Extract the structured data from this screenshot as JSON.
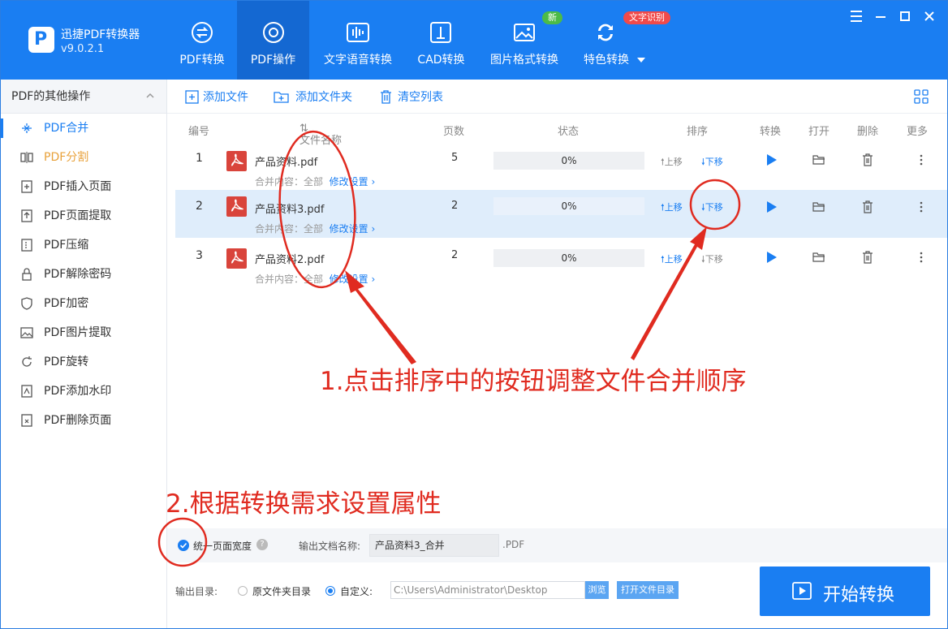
{
  "app": {
    "name": "迅捷PDF转换器",
    "version": "v9.0.2.1"
  },
  "nav_tabs": [
    {
      "label": "PDF转换",
      "icon": "pdf-convert-icon"
    },
    {
      "label": "PDF操作",
      "icon": "pdf-operate-icon",
      "active": true
    },
    {
      "label": "文字语音转换",
      "icon": "voice-wave-icon"
    },
    {
      "label": "CAD转换",
      "icon": "cad-icon"
    },
    {
      "label": "图片格式转换",
      "icon": "image-icon"
    },
    {
      "label": "特色转换",
      "icon": "special-convert-icon"
    }
  ],
  "badges": {
    "new": "新",
    "ocr": "文字识别"
  },
  "sidebar": {
    "title": "PDF的其他操作",
    "items": [
      {
        "label": "PDF合并",
        "icon": "merge-icon",
        "active": true
      },
      {
        "label": "PDF分割",
        "icon": "split-icon"
      },
      {
        "label": "PDF插入页面",
        "icon": "insert-page-icon"
      },
      {
        "label": "PDF页面提取",
        "icon": "extract-page-icon"
      },
      {
        "label": "PDF压缩",
        "icon": "compress-icon"
      },
      {
        "label": "PDF解除密码",
        "icon": "unlock-icon"
      },
      {
        "label": "PDF加密",
        "icon": "shield-icon"
      },
      {
        "label": "PDF图片提取",
        "icon": "image-extract-icon"
      },
      {
        "label": "PDF旋转",
        "icon": "rotate-icon"
      },
      {
        "label": "PDF添加水印",
        "icon": "watermark-icon"
      },
      {
        "label": "PDF删除页面",
        "icon": "delete-page-icon"
      }
    ]
  },
  "toolbar": {
    "add_file": "添加文件",
    "add_folder": "添加文件夹",
    "clear_list": "清空列表"
  },
  "table": {
    "headers": {
      "num": "编号",
      "name": "文件名称",
      "pages": "页数",
      "status": "状态",
      "sort": "排序",
      "convert": "转换",
      "open": "打开",
      "delete": "删除",
      "more": "更多"
    },
    "merge_label": "合并内容：全部",
    "modify_label": "修改设置",
    "up_label": "上移",
    "down_label": "下移",
    "rows": [
      {
        "num": "1",
        "name": "产品资料.pdf",
        "pages": "5",
        "progress": "0%"
      },
      {
        "num": "2",
        "name": "产品资料3.pdf",
        "pages": "2",
        "progress": "0%"
      },
      {
        "num": "3",
        "name": "产品资料2.pdf",
        "pages": "2",
        "progress": "0%"
      }
    ]
  },
  "annotations": {
    "note1": "1.点击排序中的按钮调整文件合并顺序",
    "note2": "2.根据转换需求设置属性"
  },
  "options": {
    "unify_width": "统一页面宽度",
    "output_name_label": "输出文档名称:",
    "output_name_value": "产品资料3_合并",
    "ext": ".PDF",
    "output_dir_label": "输出目录:",
    "source_dir": "原文件夹目录",
    "custom": "自定义:",
    "path": "C:\\Users\\Administrator\\Desktop",
    "browse": "浏览",
    "open_dir": "打开文件目录",
    "start": "开始转换"
  },
  "colors": {
    "accent": "#1a7ef2",
    "annotation": "#e02b20",
    "new_badge": "#4cbb47",
    "ocr_badge": "#f04a4a"
  }
}
